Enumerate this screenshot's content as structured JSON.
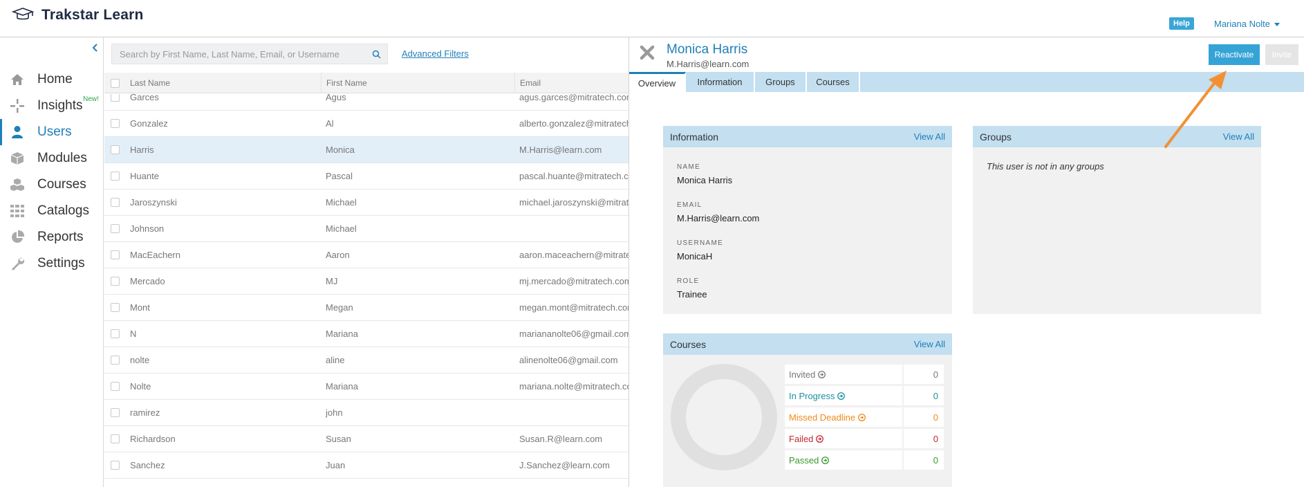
{
  "app": {
    "name": "Trakstar Learn",
    "help_label": "Help",
    "user_name": "Mariana Nolte"
  },
  "sidebar": {
    "items": [
      {
        "label": "Home",
        "icon": "home-icon"
      },
      {
        "label": "Insights",
        "icon": "insights-icon",
        "badge": "New!"
      },
      {
        "label": "Users",
        "icon": "user-icon",
        "active": true
      },
      {
        "label": "Modules",
        "icon": "cube-icon"
      },
      {
        "label": "Courses",
        "icon": "cubes-icon"
      },
      {
        "label": "Catalogs",
        "icon": "grid-icon"
      },
      {
        "label": "Reports",
        "icon": "pie-chart-icon"
      },
      {
        "label": "Settings",
        "icon": "wrench-icon"
      }
    ]
  },
  "list": {
    "search_placeholder": "Search by First Name, Last Name, Email, or Username",
    "advanced_filters": "Advanced Filters",
    "columns": [
      "Last Name",
      "First Name",
      "Email"
    ],
    "rows": [
      {
        "last": "Garces",
        "first": "Agus",
        "email": "agus.garces@mitratech.com"
      },
      {
        "last": "Gonzalez",
        "first": "Al",
        "email": "alberto.gonzalez@mitratech.com"
      },
      {
        "last": "Harris",
        "first": "Monica",
        "email": "M.Harris@learn.com",
        "selected": true
      },
      {
        "last": "Huante",
        "first": "Pascal",
        "email": "pascal.huante@mitratech.com"
      },
      {
        "last": "Jaroszynski",
        "first": "Michael",
        "email": "michael.jaroszynski@mitratech.com"
      },
      {
        "last": "Johnson",
        "first": "Michael",
        "email": ""
      },
      {
        "last": "MacEachern",
        "first": "Aaron",
        "email": "aaron.maceachern@mitratech.com"
      },
      {
        "last": "Mercado",
        "first": "MJ",
        "email": "mj.mercado@mitratech.com"
      },
      {
        "last": "Mont",
        "first": "Megan",
        "email": "megan.mont@mitratech.com"
      },
      {
        "last": "N",
        "first": "Mariana",
        "email": "mariananolte06@gmail.com"
      },
      {
        "last": "nolte",
        "first": "aline",
        "email": "alinenolte06@gmail.com"
      },
      {
        "last": "Nolte",
        "first": "Mariana",
        "email": "mariana.nolte@mitratech.com"
      },
      {
        "last": "ramirez",
        "first": "john",
        "email": ""
      },
      {
        "last": "Richardson",
        "first": "Susan",
        "email": "Susan.R@learn.com"
      },
      {
        "last": "Sanchez",
        "first": "Juan",
        "email": "J.Sanchez@learn.com"
      }
    ]
  },
  "detail": {
    "name": "Monica Harris",
    "email": "M.Harris@learn.com",
    "reactivate_label": "Reactivate",
    "invite_label": "Invite",
    "tabs": [
      "Overview",
      "Information",
      "Groups",
      "Courses"
    ],
    "info_panel": {
      "title": "Information",
      "view_all": "View All",
      "fields": [
        {
          "label": "NAME",
          "value": "Monica Harris"
        },
        {
          "label": "EMAIL",
          "value": "M.Harris@learn.com"
        },
        {
          "label": "USERNAME",
          "value": "MonicaH"
        },
        {
          "label": "ROLE",
          "value": "Trainee"
        }
      ]
    },
    "groups_panel": {
      "title": "Groups",
      "view_all": "View All",
      "empty_text": "This user is not in any groups"
    },
    "courses_panel": {
      "title": "Courses",
      "view_all": "View All",
      "stats": [
        {
          "label": "Invited",
          "count": "0",
          "color": "#777777"
        },
        {
          "label": "In Progress",
          "count": "0",
          "color": "#1a8fa0"
        },
        {
          "label": "Missed Deadline",
          "count": "0",
          "color": "#f0891c"
        },
        {
          "label": "Failed",
          "count": "0",
          "color": "#c0282e"
        },
        {
          "label": "Passed",
          "count": "0",
          "color": "#3a9a2c"
        }
      ]
    }
  },
  "colors": {
    "accent": "#1f7fb8",
    "button": "#35a3d6",
    "panel_header": "#c3dff0",
    "annotation_arrow": "#f39034"
  }
}
